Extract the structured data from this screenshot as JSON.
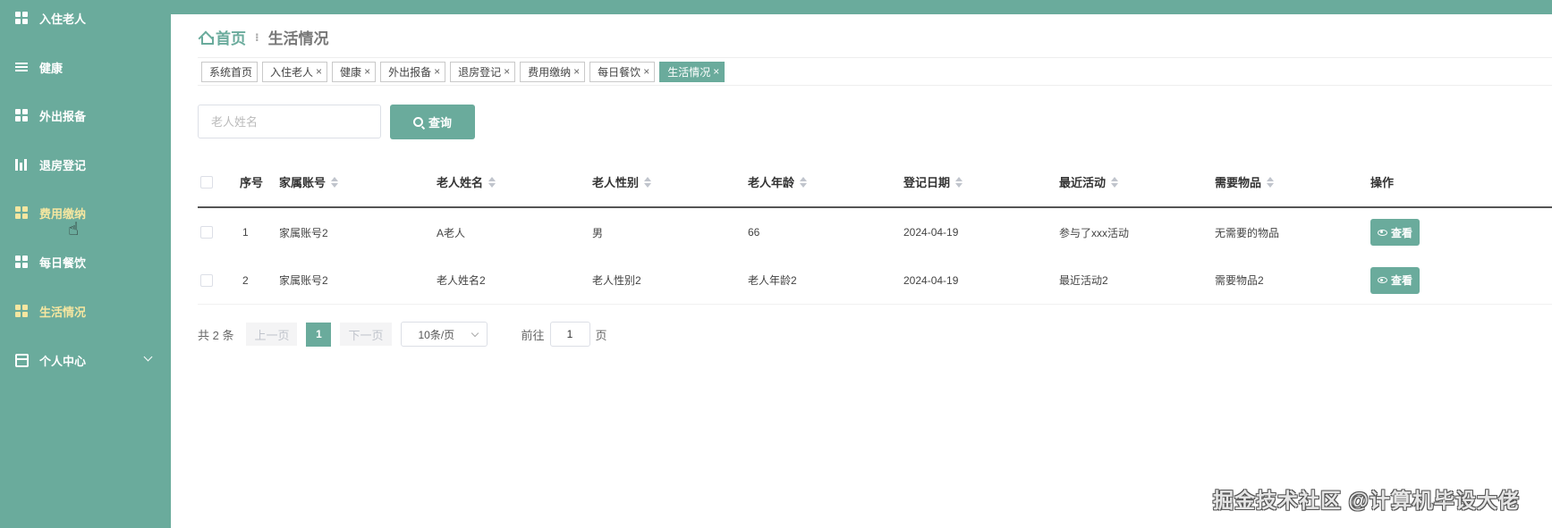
{
  "sidebar": {
    "items": [
      {
        "label": "入住老人",
        "icon": "grid-icon"
      },
      {
        "label": "健康",
        "icon": "list-icon"
      },
      {
        "label": "外出报备",
        "icon": "grid-icon"
      },
      {
        "label": "退房登记",
        "icon": "bar-icon"
      },
      {
        "label": "费用缴纳",
        "icon": "grid-icon",
        "hovered": true
      },
      {
        "label": "每日餐饮",
        "icon": "grid-icon"
      },
      {
        "label": "生活情况",
        "icon": "grid-icon",
        "active": true
      },
      {
        "label": "个人中心",
        "icon": "card-icon",
        "expandable": true
      }
    ]
  },
  "breadcrumb": {
    "home": "首页",
    "separator": "⁝",
    "current": "生活情况"
  },
  "tags": [
    {
      "label": "系统首页",
      "closable": false
    },
    {
      "label": "入住老人",
      "closable": true
    },
    {
      "label": "健康",
      "closable": true
    },
    {
      "label": "外出报备",
      "closable": true
    },
    {
      "label": "退房登记",
      "closable": true
    },
    {
      "label": "费用缴纳",
      "closable": true
    },
    {
      "label": "每日餐饮",
      "closable": true
    },
    {
      "label": "生活情况",
      "closable": true,
      "active": true
    }
  ],
  "search": {
    "placeholder": "老人姓名",
    "button_label": "查询"
  },
  "table": {
    "columns": [
      "序号",
      "家属账号",
      "老人姓名",
      "老人性别",
      "老人年龄",
      "登记日期",
      "最近活动",
      "需要物品",
      "操作"
    ],
    "rows": [
      {
        "index": "1",
        "account": "家属账号2",
        "name": "A老人",
        "gender": "男",
        "age": "66",
        "date": "2024-04-19",
        "activity": "参与了xxx活动",
        "items": "无需要的物品",
        "action": "查看"
      },
      {
        "index": "2",
        "account": "家属账号2",
        "name": "老人姓名2",
        "gender": "老人性别2",
        "age": "老人年龄2",
        "date": "2024-04-19",
        "activity": "最近活动2",
        "items": "需要物品2",
        "action": "查看"
      }
    ]
  },
  "pagination": {
    "total": "共 2 条",
    "prev": "上一页",
    "current": "1",
    "next": "下一页",
    "page_size": "10条/页",
    "goto_label": "前往",
    "goto_value": "1",
    "page_suffix": "页"
  },
  "watermark": "掘金技术社区 @计算机毕设大佬",
  "colors": {
    "accent": "#6aab9c",
    "active_text": "#f5e6a0"
  }
}
